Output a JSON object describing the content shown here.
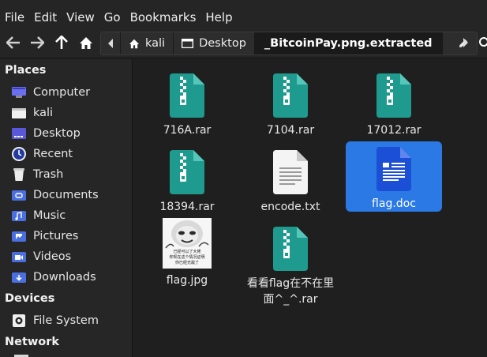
{
  "menu": [
    "File",
    "Edit",
    "View",
    "Go",
    "Bookmarks",
    "Help"
  ],
  "breadcrumb": {
    "items": [
      "kali",
      "Desktop",
      "_BitcoinPay.png.extracted"
    ]
  },
  "sidebar": {
    "places_title": "Places",
    "places": [
      "Computer",
      "kali",
      "Desktop",
      "Recent",
      "Trash",
      "Documents",
      "Music",
      "Pictures",
      "Videos",
      "Downloads"
    ],
    "devices_title": "Devices",
    "devices": [
      "File System"
    ],
    "network_title": "Network"
  },
  "files": [
    {
      "name": "716A.rar",
      "type": "archive"
    },
    {
      "name": "7104.rar",
      "type": "archive"
    },
    {
      "name": "17012.rar",
      "type": "archive"
    },
    {
      "name": "18394.rar",
      "type": "archive"
    },
    {
      "name": "encode.txt",
      "type": "text"
    },
    {
      "name": "flag.doc",
      "type": "document",
      "selected": true
    },
    {
      "name": "flag.jpg",
      "type": "image"
    },
    {
      "name": "看看flag在不在里面^_^.rar",
      "type": "archive"
    }
  ],
  "meme_text": [
    "已经可以了大佬",
    "你现在这个情况证明",
    "你已经无敌了"
  ],
  "colors": {
    "accent": "#2a79e4",
    "archive": "#1f9a8e",
    "doc": "#1a4fd6"
  }
}
